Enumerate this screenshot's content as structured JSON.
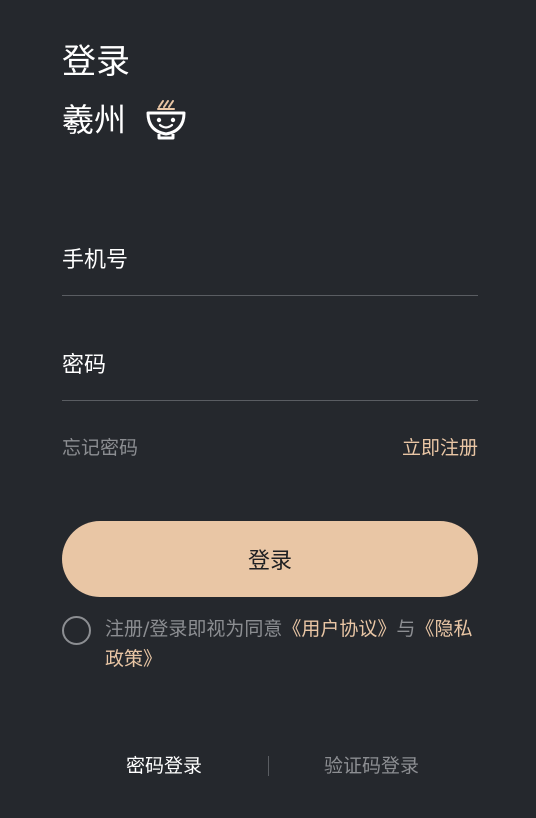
{
  "header": {
    "title": "登录",
    "brand_name": "羲州",
    "brand_logo": "noodle-bowl-icon"
  },
  "form": {
    "phone_placeholder": "手机号",
    "password_placeholder": "密码",
    "forgot_label": "忘记密码",
    "register_label": "立即注册",
    "submit_label": "登录"
  },
  "agreement": {
    "prefix": "注册/登录即视为同意",
    "user_agreement": "《用户协议》",
    "conjunction": "与",
    "privacy_policy": "《隐私政策》"
  },
  "tabs": {
    "password_login": "密码登录",
    "code_login": "验证码登录",
    "active": "password_login"
  },
  "colors": {
    "background": "#25282d",
    "accent": "#e9c6a5",
    "muted": "#8c8e92"
  }
}
